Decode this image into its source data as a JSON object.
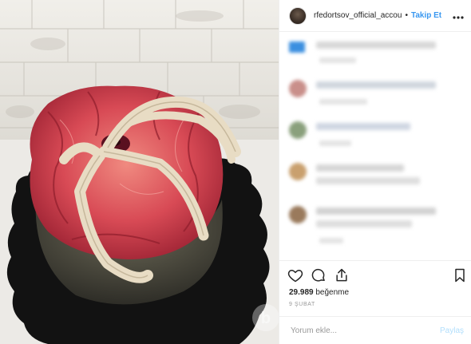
{
  "header": {
    "username": "rfedortsov_official_accou",
    "separator": "•",
    "follow_label": "Takip Et",
    "more_icon": "more-horizontal-icon"
  },
  "comments": {
    "blurred": true,
    "count": 5
  },
  "actions": {
    "like_icon": "heart-icon",
    "comment_icon": "comment-bubble-icon",
    "share_icon": "share-icon",
    "save_icon": "bookmark-icon"
  },
  "likes": {
    "count": "29.989",
    "label": "beğenme"
  },
  "date": "9 ŞUBAT",
  "comment_box": {
    "placeholder": "Yorum ekle...",
    "post_label": "Paylaş"
  },
  "colors": {
    "accent": "#3897f0",
    "post_disabled": "#b2dffc",
    "text": "#262626",
    "border": "#efefef"
  }
}
